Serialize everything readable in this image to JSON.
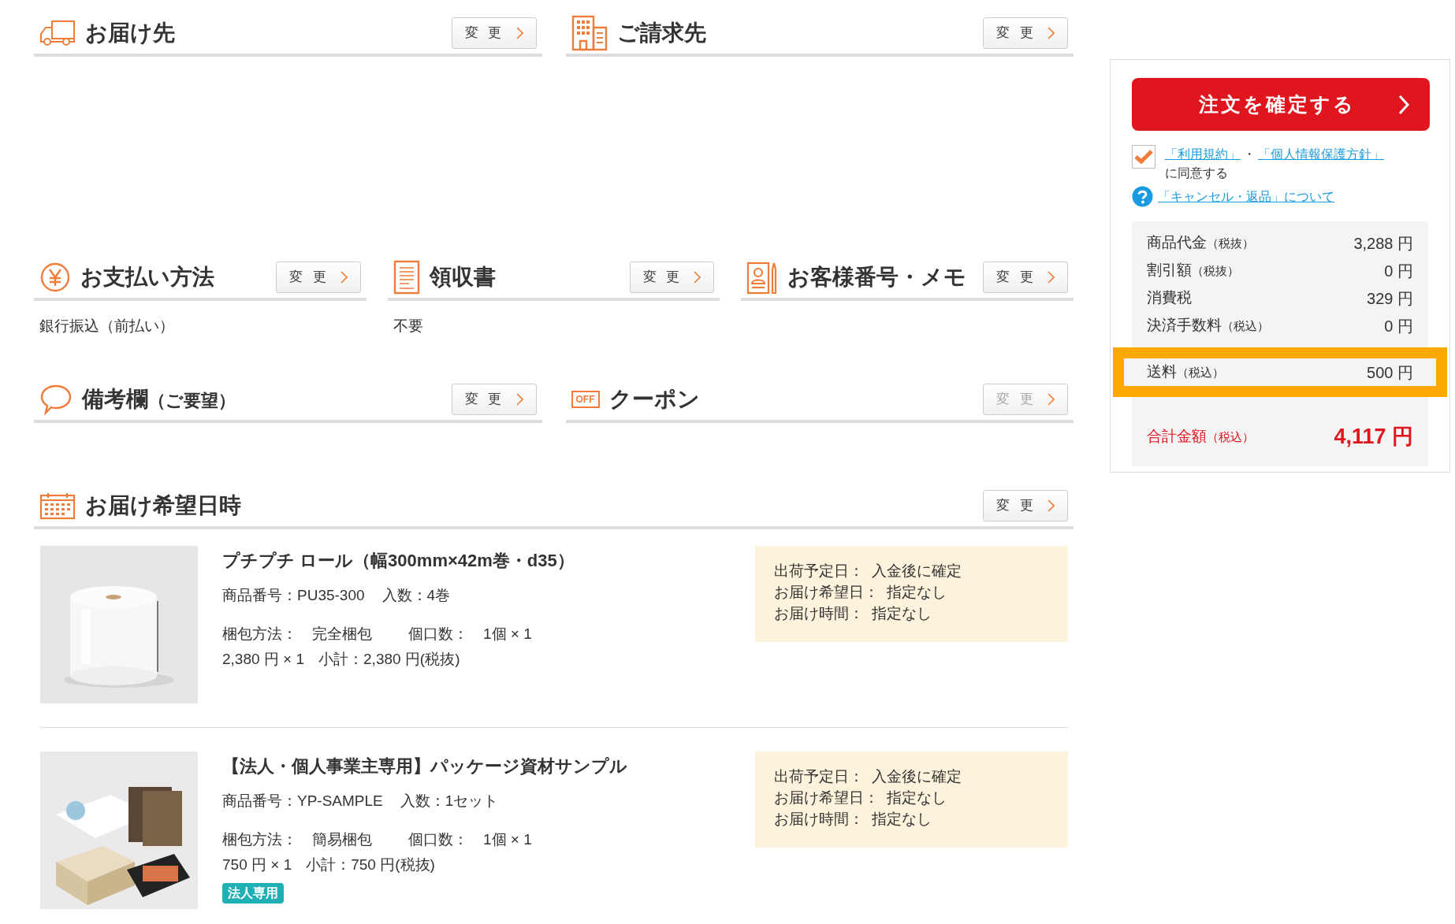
{
  "sections": [
    [
      {
        "title": "お届け先",
        "button": "変 更",
        "disabled": false
      },
      {
        "title": "ご請求先",
        "button": "変 更",
        "disabled": false
      }
    ],
    [
      {
        "title": "お支払い方法",
        "button": "変 更",
        "disabled": false,
        "body": "銀行振込（前払い）"
      },
      {
        "title": "領収書",
        "button": "変 更",
        "disabled": false,
        "body": "不要"
      },
      {
        "title": "お客様番号・メモ",
        "button": "変 更",
        "disabled": false
      }
    ],
    [
      {
        "title": "備考欄",
        "title_note": "（ご要望）",
        "button": "変 更",
        "disabled": false
      },
      {
        "icon_text": "OFF",
        "title": "クーポン",
        "button": "変 更",
        "disabled": true
      }
    ],
    [
      {
        "title": "お届け希望日時",
        "button": "変 更",
        "disabled": false
      }
    ]
  ],
  "products": [
    {
      "title": "プチプチ ロール（幅300mm×42m巻・d35）",
      "item_no": "商品番号：PU35-300",
      "quantity": "入数：4巻",
      "packing": "梱包方法：　完全梱包",
      "parcels": "個口数：　1個 × 1",
      "price": "2,380 円 × 1",
      "subtotal": "小計：2,380 円(税抜)",
      "delivery": [
        {
          "label": "出荷予定日：",
          "value": "入金後に確定"
        },
        {
          "label": "お届け希望日：",
          "value": "指定なし"
        },
        {
          "label": "お届け時間：",
          "value": "指定なし"
        }
      ]
    },
    {
      "title": "【法人・個人事業主専用】パッケージ資材サンプル",
      "item_no": "商品番号：YP-SAMPLE",
      "quantity": "入数：1セット",
      "packing": "梱包方法：　簡易梱包",
      "parcels": "個口数：　1個 × 1",
      "price": "750 円 × 1",
      "subtotal": "小計：750 円(税抜)",
      "tag": "法人専用",
      "delivery": [
        {
          "label": "出荷予定日：",
          "value": "入金後に確定"
        },
        {
          "label": "お届け希望日：",
          "value": "指定なし"
        },
        {
          "label": "お届け時間：",
          "value": "指定なし"
        }
      ]
    }
  ],
  "order_panel": {
    "confirm_button": "注文を確定する",
    "agree": {
      "checked": true,
      "link_terms": "「利用規約」",
      "separator": "・",
      "link_privacy": "「個人情報保護方針」",
      "text": "に同意する"
    },
    "cancel_link": "「キャンセル・返品」について",
    "summary": [
      {
        "kind": "row",
        "label": "商品代金",
        "note": "（税抜）",
        "value": "3,288 円",
        "highlighted": false
      },
      {
        "kind": "row",
        "label": "割引額",
        "note": "（税抜）",
        "value": "0 円",
        "highlighted": false
      },
      {
        "kind": "row",
        "label": "消費税",
        "value": "329 円",
        "highlighted": false
      },
      {
        "kind": "row",
        "label": "決済手数料",
        "note": "（税込）",
        "value": "0 円",
        "highlighted": false
      },
      {
        "kind": "row",
        "label": "送料",
        "note": "（税込）",
        "value": "500 円",
        "highlighted": true
      },
      {
        "kind": "total",
        "label": "合計金額",
        "note": "（税込）",
        "value": "4,117 円",
        "highlighted": false
      }
    ]
  }
}
